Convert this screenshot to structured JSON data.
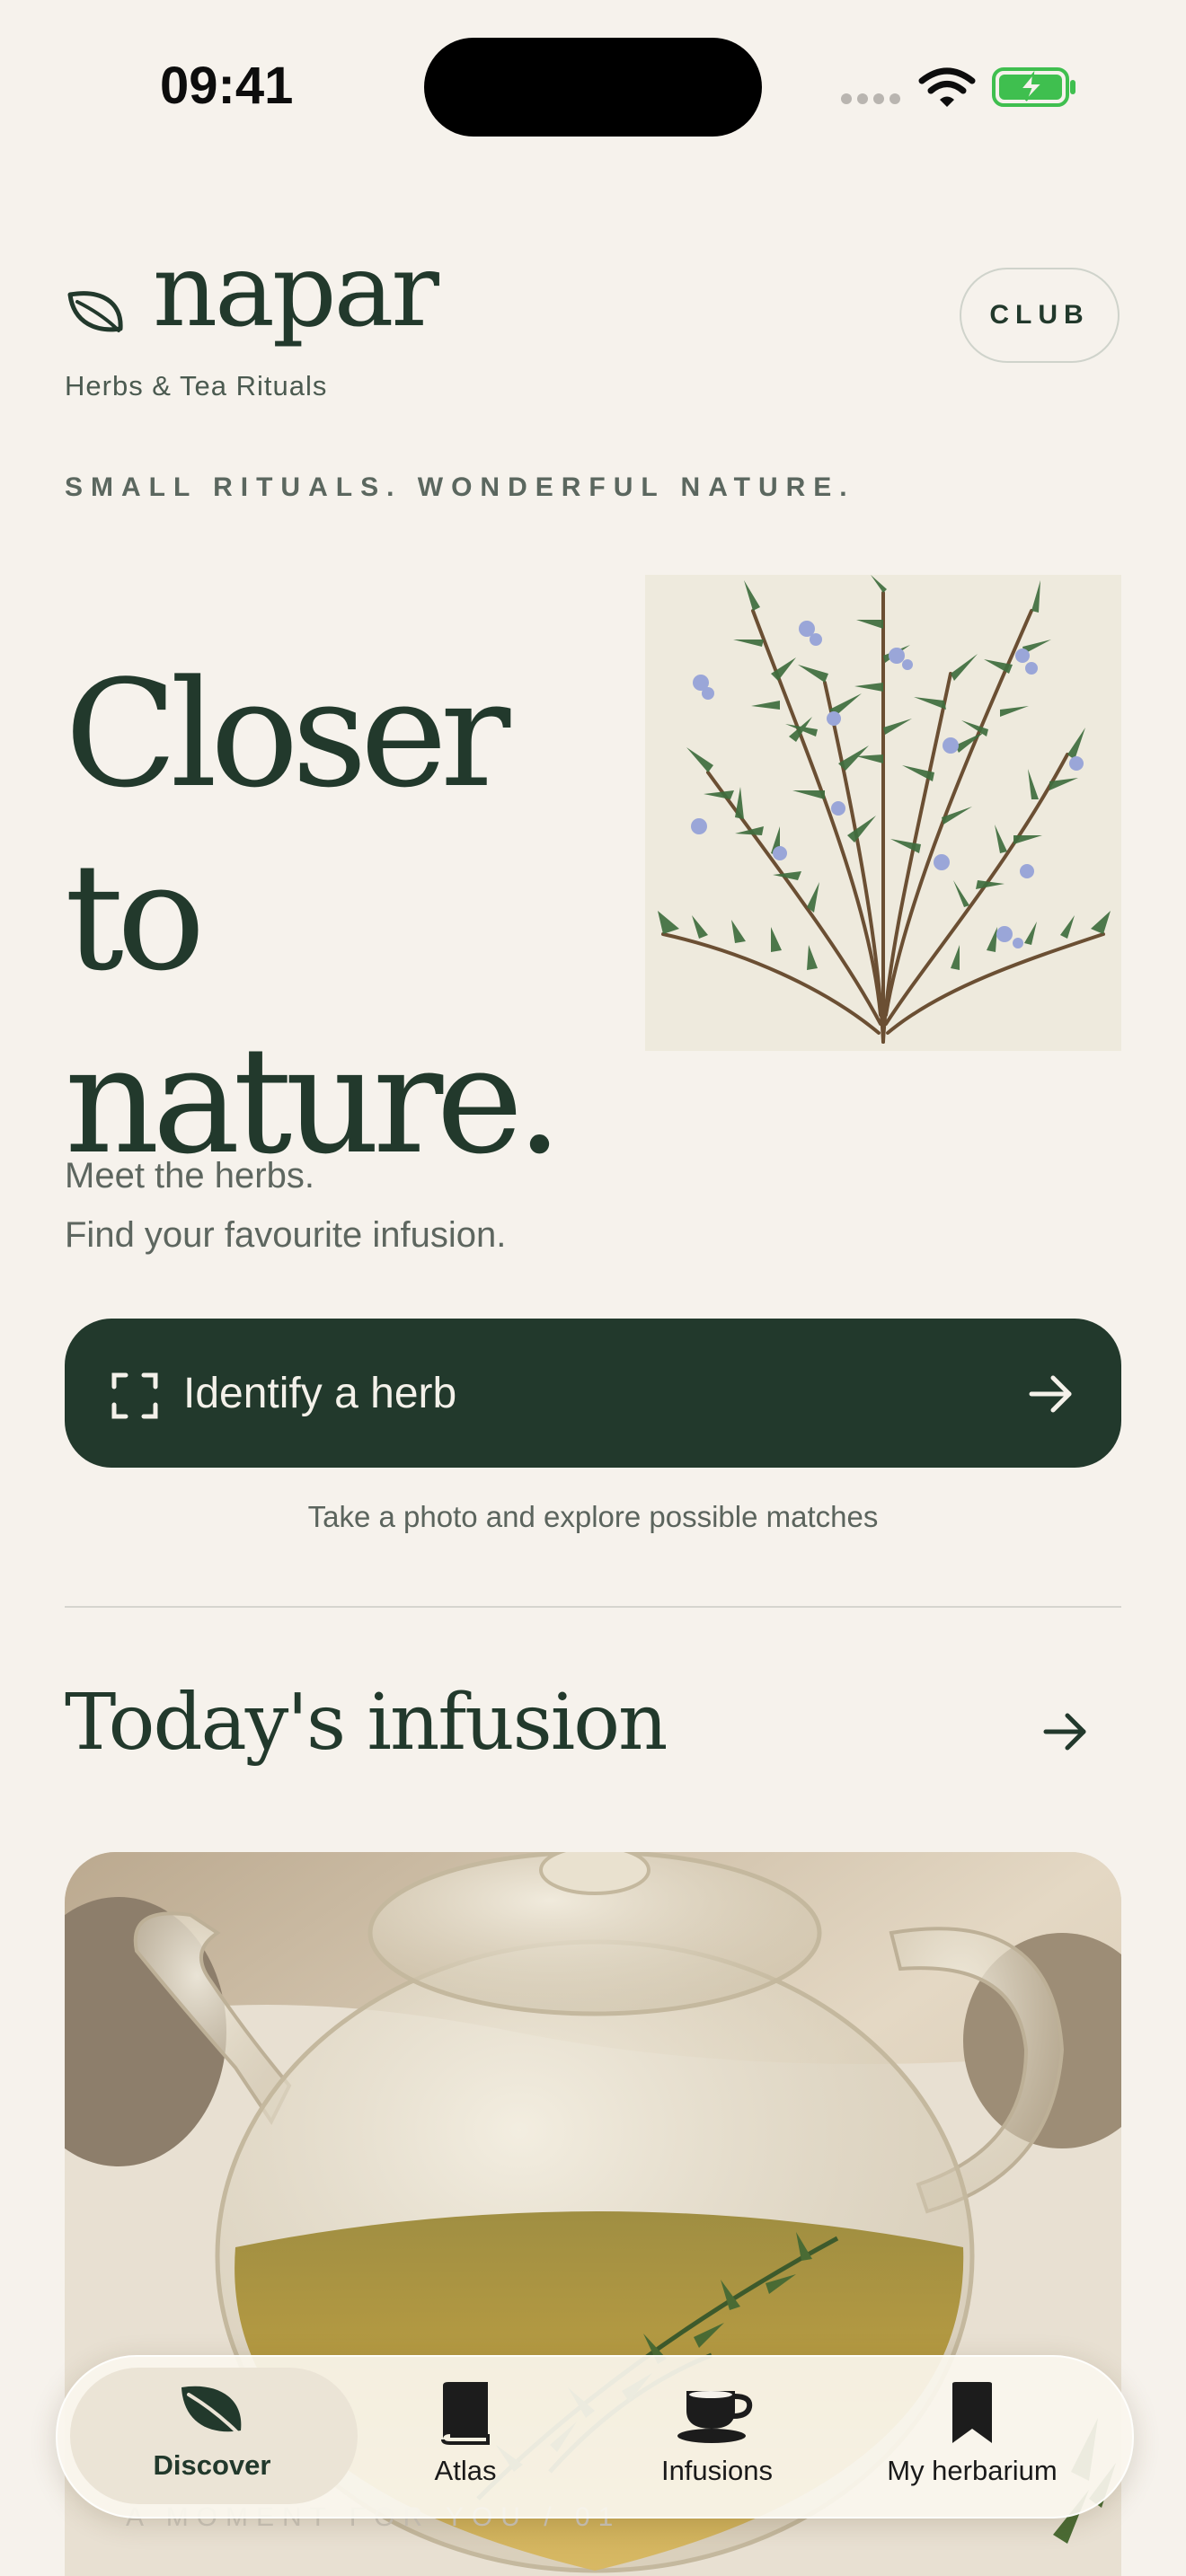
{
  "status_bar": {
    "time": "09:41",
    "battery": "charging"
  },
  "brand": {
    "name": "napar",
    "tagline": "Herbs & Tea Rituals",
    "club_label": "CLUB"
  },
  "motto": "SMALL RITUALS. WONDERFUL NATURE.",
  "hero": {
    "line1": "Closer to",
    "line2": "nature."
  },
  "intro": {
    "line1": "Meet the herbs.",
    "line2": "Find your favourite infusion."
  },
  "identify": {
    "label": "Identify a herb",
    "hint": "Take a photo and explore possible matches"
  },
  "todays_infusion": {
    "title": "Today's infusion",
    "under_text": "A MOMENT FOR YOU / 01"
  },
  "nav": {
    "items": [
      {
        "label": "Discover",
        "icon": "leaf-icon",
        "active": true
      },
      {
        "label": "Atlas",
        "icon": "book-icon"
      },
      {
        "label": "Infusions",
        "icon": "cup-icon"
      },
      {
        "label": "My herbarium",
        "icon": "bookmark-icon"
      }
    ]
  },
  "colors": {
    "brand_green": "#22392c",
    "background": "#f6f2ec",
    "battery_green": "#3fbf4f"
  }
}
